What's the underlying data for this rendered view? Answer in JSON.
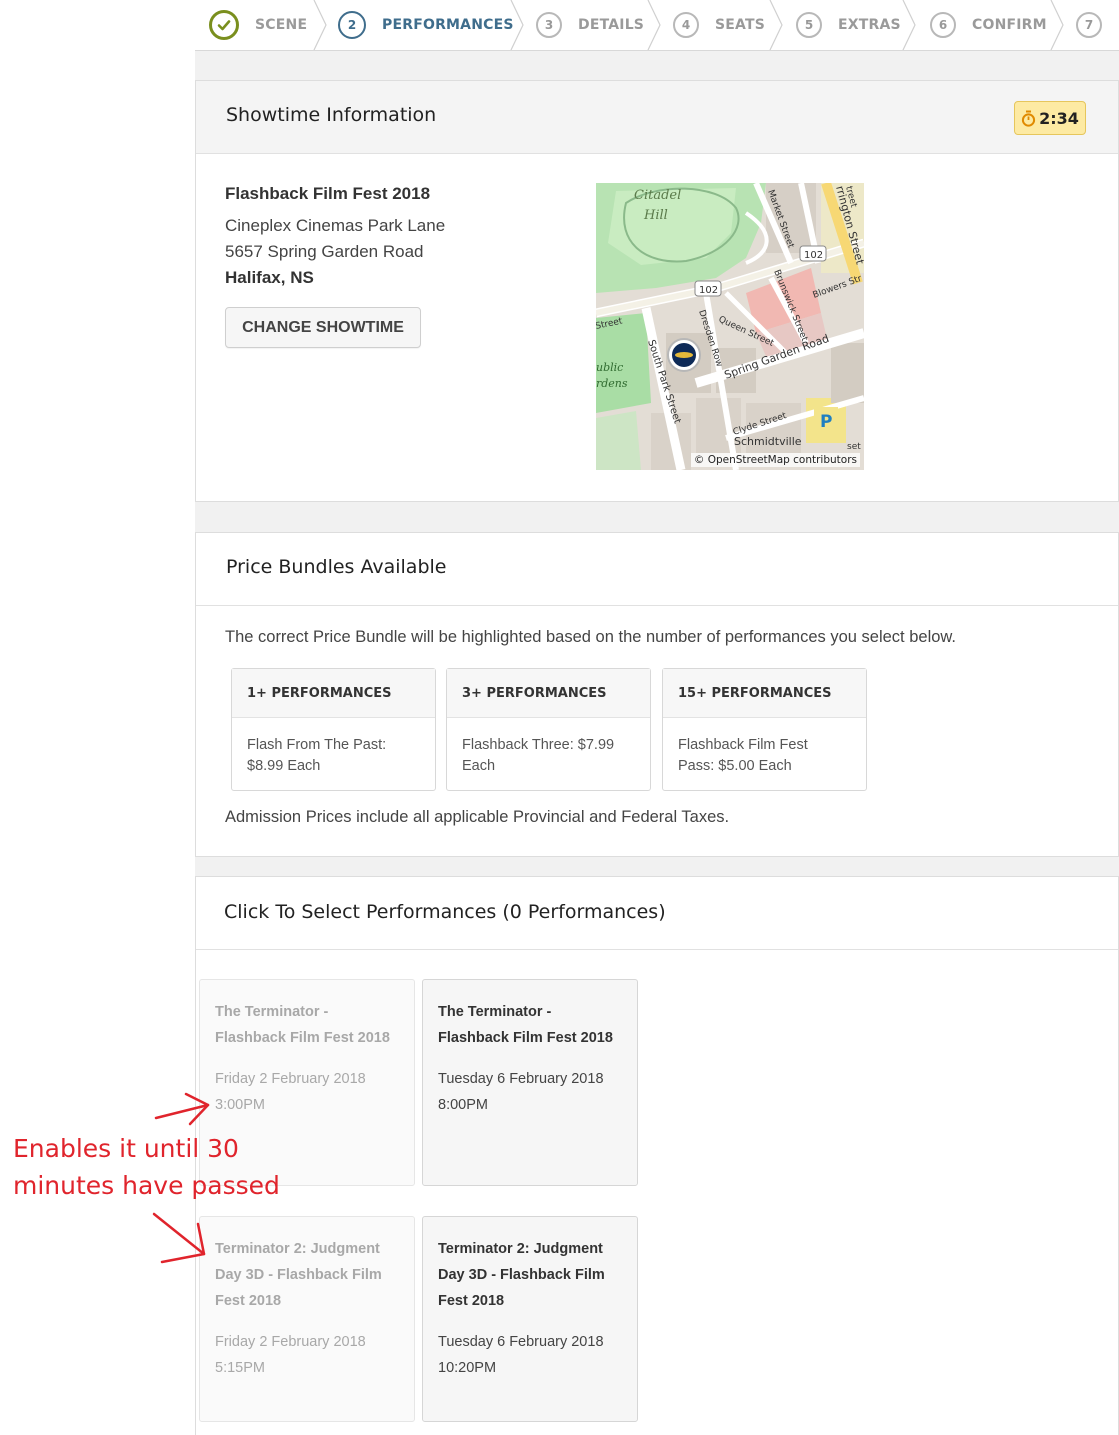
{
  "stepper": {
    "steps": [
      {
        "num": "",
        "label": "SCENE",
        "state": "done"
      },
      {
        "num": "2",
        "label": "PERFORMANCES",
        "state": "active"
      },
      {
        "num": "3",
        "label": "DETAILS",
        "state": "todo"
      },
      {
        "num": "4",
        "label": "SEATS",
        "state": "todo"
      },
      {
        "num": "5",
        "label": "EXTRAS",
        "state": "todo"
      },
      {
        "num": "6",
        "label": "CONFIRM",
        "state": "todo"
      },
      {
        "num": "7",
        "label": "",
        "state": "todo"
      }
    ]
  },
  "showtime": {
    "title": "Showtime Information",
    "timer": "2:34",
    "event_name": "Flashback Film Fest 2018",
    "venue": "Cineplex Cinemas Park Lane",
    "address": "5657 Spring Garden Road",
    "city": "Halifax, NS",
    "change_button": "CHANGE SHOWTIME",
    "map": {
      "labels": {
        "citadel": "Citadel",
        "hill": "Hill",
        "market": "Market Street",
        "barrington": "rrington Street",
        "route102a": "102",
        "route102b": "102",
        "blowers": "Blowers Str",
        "brunswick": "Brunswick Street",
        "dresden": "Dresden Row",
        "queen": "Queen Street",
        "spring_garden": "Spring Garden Road",
        "south_park": "South Park Street",
        "street_w": "Street",
        "public": "ublic",
        "gardens": "rdens",
        "clyde": "Clyde Street",
        "schmidtville": "Schmidtville",
        "parking": "P",
        "edge_top": "treet",
        "edge_bottom": "set"
      },
      "attribution": "© OpenStreetMap contributors"
    }
  },
  "bundles": {
    "title": "Price Bundles Available",
    "intro": "The correct Price Bundle will be highlighted based on the number of performances you select below.",
    "items": [
      {
        "header": "1+ PERFORMANCES",
        "line1": "Flash From The Past:",
        "line2": "$8.99 Each"
      },
      {
        "header": "3+ PERFORMANCES",
        "line1": "Flashback Three: $7.99",
        "line2": "Each"
      },
      {
        "header": "15+ PERFORMANCES",
        "line1": "Flashback Film Fest",
        "line2": "Pass: $5.00 Each"
      }
    ],
    "tax_note": "Admission Prices include all applicable Provincial and Federal Taxes."
  },
  "performances": {
    "title": "Click To Select Performances (0 Performances)",
    "items": [
      {
        "title1": "The Terminator -",
        "title2": "Flashback Film Fest 2018",
        "title3": "",
        "date": "Friday 2 February 2018",
        "time": "3:00PM",
        "disabled": true
      },
      {
        "title1": "The Terminator -",
        "title2": "Flashback Film Fest 2018",
        "title3": "",
        "date": "Tuesday 6 February 2018",
        "time": "8:00PM",
        "disabled": false
      },
      {
        "title1": "Terminator 2: Judgment",
        "title2": "Day 3D - Flashback Film",
        "title3": "Fest 2018",
        "date": "Friday 2 February 2018",
        "time": "5:15PM",
        "disabled": true
      },
      {
        "title1": "Terminator 2: Judgment",
        "title2": "Day 3D - Flashback Film",
        "title3": "Fest 2018",
        "date": "Tuesday 6 February 2018",
        "time": "10:20PM",
        "disabled": false
      }
    ]
  },
  "annotation": {
    "line1": "Enables it until 30",
    "line2": "minutes have passed",
    "color": "#e0242c"
  }
}
